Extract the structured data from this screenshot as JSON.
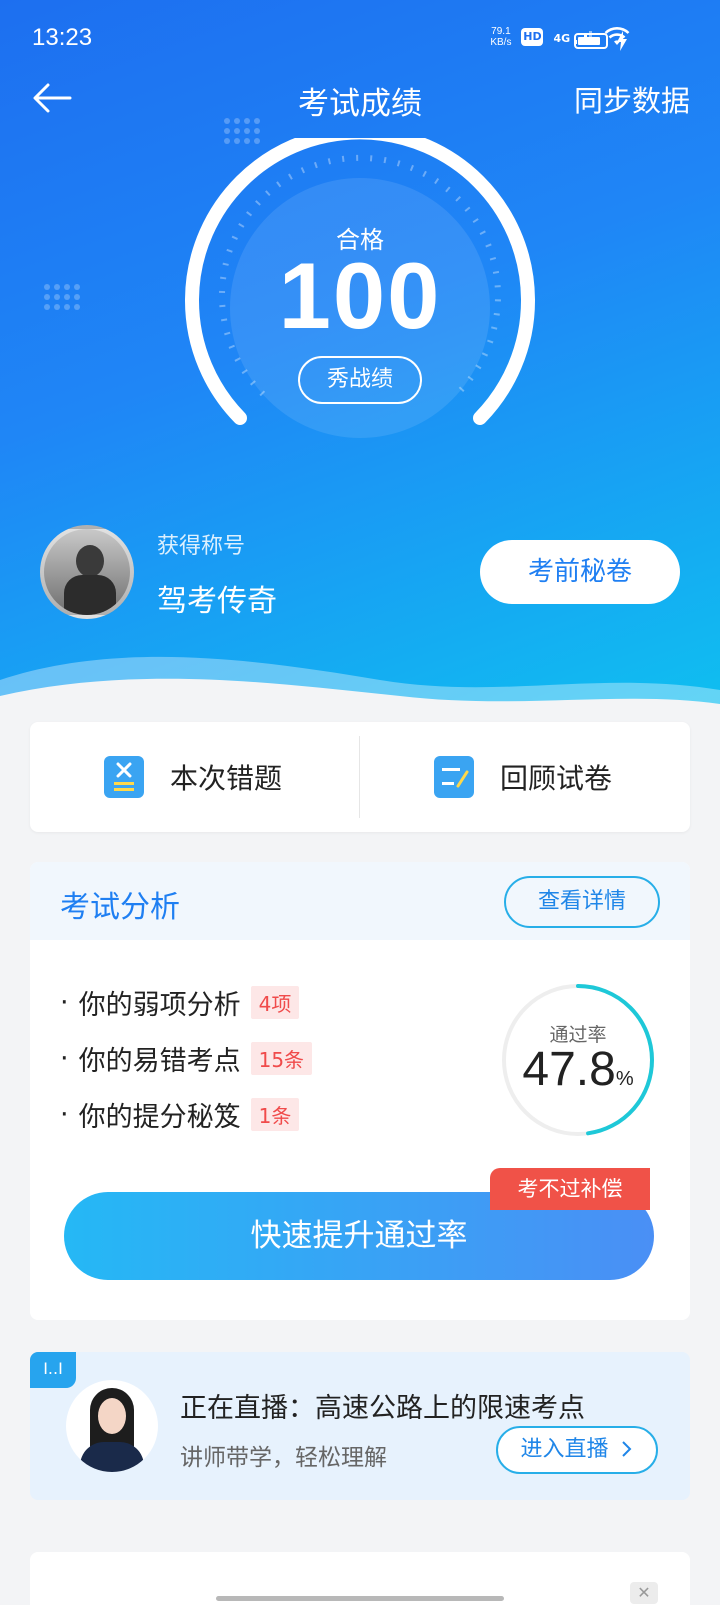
{
  "status": {
    "time": "13:23",
    "net_speed_top": "79.1",
    "net_speed_unit": "KB/s",
    "hd": "HD",
    "network": "4G"
  },
  "nav": {
    "title": "考试成绩",
    "sync_label": "同步数据"
  },
  "score": {
    "pass_label": "合格",
    "value": "100",
    "show_label": "秀战绩"
  },
  "honor": {
    "label": "获得称号",
    "value": "驾考传奇",
    "secret_label": "考前秘卷"
  },
  "actions": [
    {
      "label": "本次错题",
      "icon": "wrong-questions-icon"
    },
    {
      "label": "回顾试卷",
      "icon": "review-paper-icon"
    }
  ],
  "analysis": {
    "title": "考试分析",
    "detail_label": "查看详情",
    "items": [
      {
        "label": "你的弱项分析",
        "tag": "4项"
      },
      {
        "label": "你的易错考点",
        "tag": "15条"
      },
      {
        "label": "你的提分秘笈",
        "tag": "1条"
      }
    ],
    "pass_rate_label": "通过率",
    "pass_rate_value": "47.8",
    "pass_rate_unit": "%",
    "pass_rate_fraction": 0.478,
    "boost_label": "快速提升通过率",
    "compensate_label": "考不过补偿"
  },
  "live": {
    "badge": "I..I",
    "title": "正在直播：高速公路上的限速考点",
    "subtitle": "讲师带学，轻松理解",
    "enter_label": "进入直播"
  },
  "colors": {
    "primary": "#1f7ff2",
    "accent_cyan": "#1ec8d8",
    "tag_red": "#f04b4b"
  }
}
